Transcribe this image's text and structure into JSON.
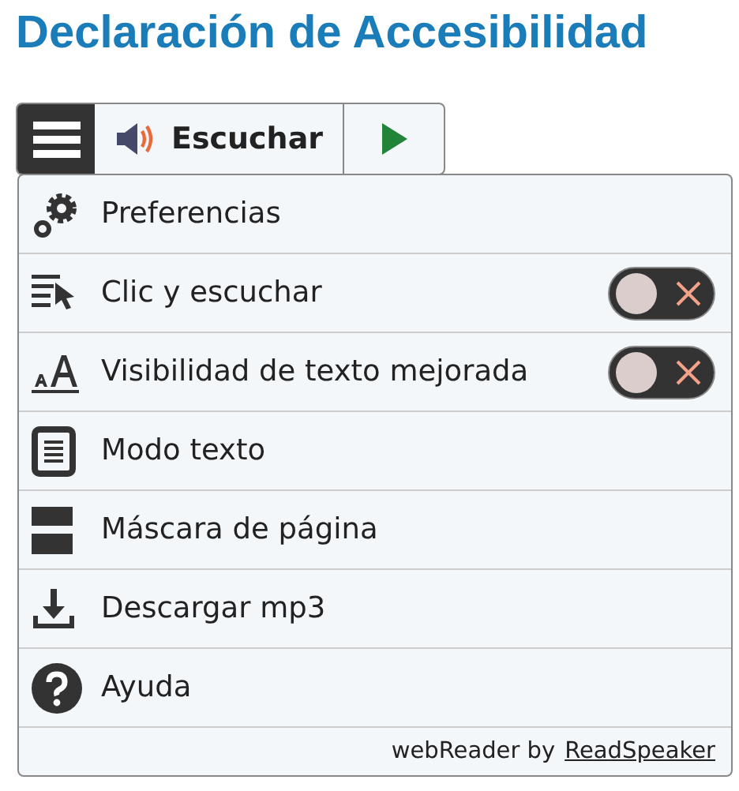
{
  "page": {
    "title": "Declaración de Accesibilidad"
  },
  "toolbar": {
    "listen_label": "Escuchar"
  },
  "menu": {
    "items": [
      {
        "kind": "link",
        "label": "Preferencias"
      },
      {
        "kind": "toggle",
        "label": "Clic y escuchar",
        "on": false
      },
      {
        "kind": "toggle",
        "label": "Visibilidad de texto mejorada",
        "on": false
      },
      {
        "kind": "link",
        "label": "Modo texto"
      },
      {
        "kind": "link",
        "label": "Máscara de página"
      },
      {
        "kind": "link",
        "label": "Descargar mp3"
      },
      {
        "kind": "link",
        "label": "Ayuda"
      }
    ],
    "footer_text": "webReader by",
    "footer_link": "ReadSpeaker"
  }
}
